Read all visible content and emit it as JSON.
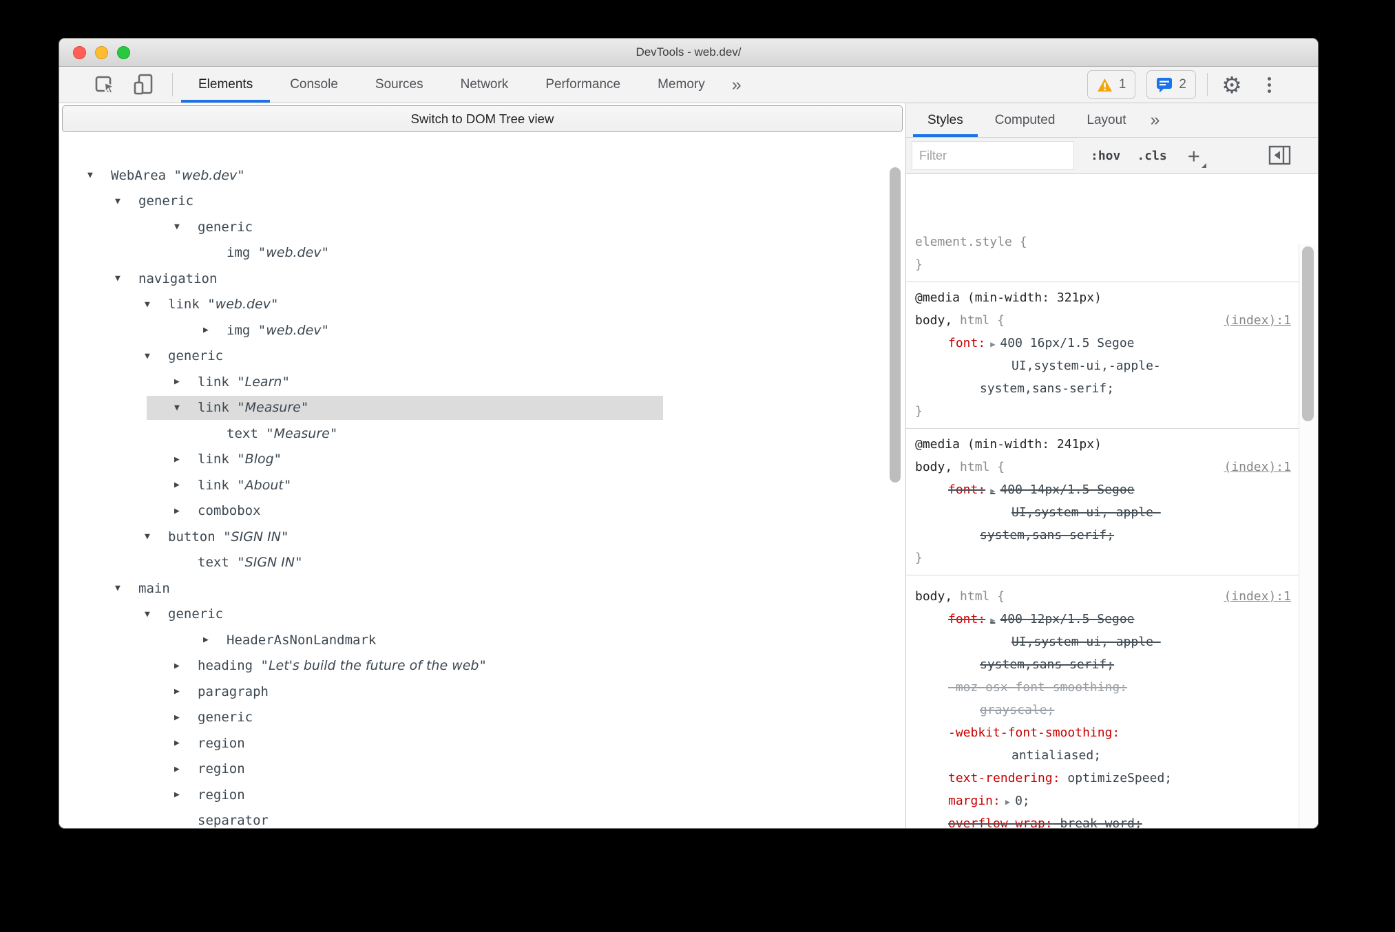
{
  "window": {
    "title": "DevTools - web.dev/"
  },
  "main_toolbar": {
    "tabs": [
      "Elements",
      "Console",
      "Sources",
      "Network",
      "Performance",
      "Memory"
    ],
    "active_tab": "Elements",
    "overflow_chevron": "»",
    "warning_count": "1",
    "message_count": "2"
  },
  "accessibility_panel": {
    "switch_button_label": "Switch to DOM Tree view",
    "tree": [
      {
        "role": "WebArea",
        "value": "web.dev",
        "arrow": "open",
        "col": 0
      },
      {
        "role": "generic",
        "arrow": "open",
        "col": 1
      },
      {
        "role": "generic",
        "arrow": "open",
        "col": 3
      },
      {
        "role": "img",
        "value": "web.dev",
        "col": 4
      },
      {
        "role": "navigation",
        "arrow": "open",
        "col": 1
      },
      {
        "role": "link",
        "value": "web.dev",
        "arrow": "open",
        "col": 2
      },
      {
        "role": "img",
        "value": "web.dev",
        "arrow": "closed",
        "col": 4
      },
      {
        "role": "generic",
        "arrow": "open",
        "col": 2
      },
      {
        "role": "link",
        "value": "Learn",
        "arrow": "closed",
        "col": 3
      },
      {
        "role": "link",
        "value": "Measure",
        "arrow": "open",
        "col": 3,
        "highlighted": true
      },
      {
        "role": "text",
        "value": "Measure",
        "col": 4
      },
      {
        "role": "link",
        "value": "Blog",
        "arrow": "closed",
        "col": 3
      },
      {
        "role": "link",
        "value": "About",
        "arrow": "closed",
        "col": 3
      },
      {
        "role": "combobox",
        "arrow": "closed",
        "col": 3
      },
      {
        "role": "button",
        "value": "SIGN IN",
        "arrow": "open",
        "col": 2
      },
      {
        "role": "text",
        "value": "SIGN IN",
        "col": 3
      },
      {
        "role": "main",
        "arrow": "open",
        "col": 1
      },
      {
        "role": "generic",
        "arrow": "open",
        "col": 2
      },
      {
        "role": "HeaderAsNonLandmark",
        "arrow": "closed",
        "col": 4
      },
      {
        "role": "heading",
        "value": "Let's build the future of the web",
        "arrow": "closed",
        "col": 3
      },
      {
        "role": "paragraph",
        "arrow": "closed",
        "col": 3
      },
      {
        "role": "generic",
        "arrow": "closed",
        "col": 3
      },
      {
        "role": "region",
        "arrow": "closed",
        "col": 3
      },
      {
        "role": "region",
        "arrow": "closed",
        "col": 3
      },
      {
        "role": "region",
        "arrow": "closed",
        "col": 3
      },
      {
        "role": "separator",
        "col": 3
      }
    ]
  },
  "styles_panel": {
    "tabs": [
      "Styles",
      "Computed",
      "Layout"
    ],
    "active_tab": "Styles",
    "overflow_chevron": "»",
    "filter_placeholder": "Filter",
    "pseudo_toggle": ":hov",
    "class_toggle": ".cls",
    "new_rule_plus": "+",
    "sections": [
      {
        "lines": [
          {
            "ind": 0,
            "segs": [
              [
                "sg",
                "element.style {"
              ]
            ]
          },
          {
            "ind": 0,
            "segs": [
              [
                "sg",
                "}"
              ]
            ]
          }
        ]
      },
      {
        "lines": [
          {
            "ind": 0,
            "segs": [
              [
                "sd",
                "@media (min-width: 321px)"
              ]
            ]
          },
          {
            "ind": 0,
            "link": "(index):1",
            "segs": [
              [
                "sd",
                "body,"
              ],
              [
                "sg",
                " html {"
              ]
            ]
          },
          {
            "ind": 48,
            "segs": [
              [
                "sp",
                "font:"
              ],
              [
                "sa",
                "▶"
              ],
              [
                "sv",
                "400 16px/1.5 Segoe"
              ]
            ]
          },
          {
            "ind": 140,
            "segs": [
              [
                "sv",
                "UI,system-ui,-apple-"
              ]
            ]
          },
          {
            "ind": 94,
            "segs": [
              [
                "sv",
                "system,sans-serif;"
              ]
            ]
          },
          {
            "ind": 0,
            "segs": [
              [
                "sg",
                "}"
              ]
            ]
          }
        ]
      },
      {
        "lines": [
          {
            "ind": 0,
            "segs": [
              [
                "sd",
                "@media (min-width: 241px)"
              ]
            ]
          },
          {
            "ind": 0,
            "link": "(index):1",
            "segs": [
              [
                "sd",
                "body,"
              ],
              [
                "sg",
                " html {"
              ]
            ]
          },
          {
            "ind": 48,
            "strike": "dark",
            "segs": [
              [
                "sp",
                "font:"
              ],
              [
                "sa",
                "▶"
              ],
              [
                "sv",
                "400 14px/1.5 Segoe"
              ]
            ]
          },
          {
            "ind": 140,
            "strike": "dark",
            "segs": [
              [
                "sv",
                "UI,system-ui,-apple-"
              ]
            ]
          },
          {
            "ind": 94,
            "strike": "dark",
            "segs": [
              [
                "sv",
                "system,sans-serif;"
              ]
            ]
          },
          {
            "ind": 0,
            "segs": [
              [
                "sg",
                "}"
              ]
            ]
          }
        ]
      },
      {
        "lines": [
          {
            "ind": 0,
            "link": "(index):1",
            "segs": [
              [
                "sd",
                "body,"
              ],
              [
                "sg",
                " html {"
              ]
            ]
          },
          {
            "ind": 48,
            "strike": "dark",
            "segs": [
              [
                "sp",
                "font:"
              ],
              [
                "sa",
                "▶"
              ],
              [
                "sv",
                "400 12px/1.5 Segoe"
              ]
            ]
          },
          {
            "ind": 140,
            "strike": "dark",
            "segs": [
              [
                "sv",
                "UI,system-ui,-apple-"
              ]
            ]
          },
          {
            "ind": 94,
            "strike": "dark",
            "segs": [
              [
                "sv",
                "system,sans-serif;"
              ]
            ]
          },
          {
            "ind": 48,
            "strike": "gray",
            "segs": [
              [
                "sg2",
                "-moz-osx-font-smoothing:"
              ]
            ]
          },
          {
            "ind": 94,
            "strike": "gray",
            "segs": [
              [
                "sg2",
                "grayscale;"
              ]
            ]
          },
          {
            "ind": 48,
            "segs": [
              [
                "sp",
                "-webkit-font-smoothing:"
              ]
            ]
          },
          {
            "ind": 140,
            "segs": [
              [
                "sv",
                "antialiased;"
              ]
            ]
          },
          {
            "ind": 48,
            "segs": [
              [
                "sp",
                "text-rendering:"
              ],
              [
                "sv",
                " optimizeSpeed;"
              ]
            ]
          },
          {
            "ind": 48,
            "segs": [
              [
                "sp",
                "margin:"
              ],
              [
                "sa",
                "▶"
              ],
              [
                "sv",
                "0;"
              ]
            ]
          },
          {
            "ind": 48,
            "strike": "dark",
            "segs": [
              [
                "sp",
                "overflow-wrap:"
              ],
              [
                "sv",
                " break-word;"
              ]
            ]
          }
        ]
      }
    ]
  }
}
